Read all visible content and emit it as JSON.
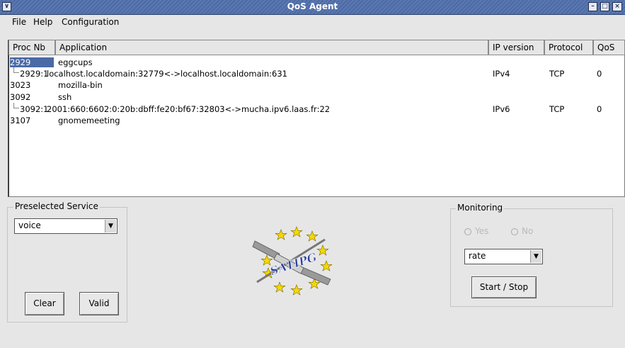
{
  "window": {
    "title": "QoS Agent"
  },
  "menu": {
    "file": "File",
    "help": "Help",
    "configuration": "Configuration"
  },
  "table": {
    "columns": [
      "Proc Nb",
      "Application",
      "IP version",
      "Protocol",
      "QoS"
    ],
    "rows": [
      {
        "proc": "2929",
        "app": "eggcups",
        "selected": true
      },
      {
        "proc": "2929:1",
        "app": "localhost.localdomain:32779<->localhost.localdomain:631",
        "ip": "IPv4",
        "protocol": "TCP",
        "qos": "0",
        "child": true
      },
      {
        "proc": "3023",
        "app": "mozilla-bin"
      },
      {
        "proc": "3092",
        "app": "ssh"
      },
      {
        "proc": "3092:1",
        "app": "2001:660:6602:0:20b:dbff:fe20:bf67:32803<->mucha.ipv6.laas.fr:22",
        "ip": "IPv6",
        "protocol": "TCP",
        "qos": "0",
        "child": true
      },
      {
        "proc": "3107",
        "app": "gnomemeeting"
      }
    ]
  },
  "preselected": {
    "label": "Preselected Service",
    "value": "voice",
    "clear": "Clear",
    "valid": "Valid"
  },
  "logo": {
    "text": "SATIPG"
  },
  "monitoring": {
    "label": "Monitoring",
    "yes": "Yes",
    "no": "No",
    "metric": "rate",
    "start_stop": "Start / Stop"
  },
  "colors": {
    "titlebar": "#5a79b3",
    "selection": "#4a6aa6",
    "stars": "#f5d800",
    "logo_text": "#2a3f9a"
  }
}
